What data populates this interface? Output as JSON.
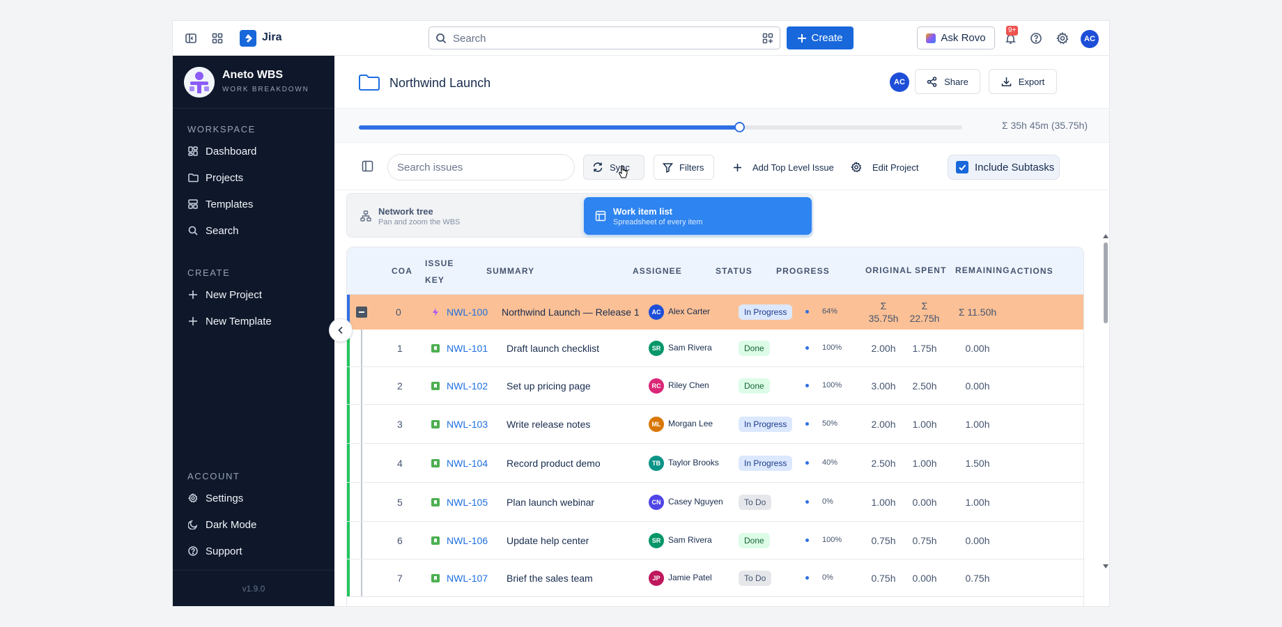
{
  "topbar": {
    "app_name": "Jira",
    "search_placeholder": "Search",
    "create_label": "Create",
    "ask_rovo_label": "Ask Rovo",
    "notification_count": "9+",
    "user_initials": "AC"
  },
  "sidebar": {
    "brand_name": "Aneto WBS",
    "brand_sub": "WORK BREAKDOWN",
    "workspace_title": "WORKSPACE",
    "workspace_items": [
      {
        "label": "Dashboard",
        "icon": "dashboard-icon"
      },
      {
        "label": "Projects",
        "icon": "folder-icon"
      },
      {
        "label": "Templates",
        "icon": "template-icon"
      },
      {
        "label": "Search",
        "icon": "search-icon"
      }
    ],
    "create_title": "CREATE",
    "create_items": [
      {
        "label": "New Project",
        "icon": "plus-icon"
      },
      {
        "label": "New Template",
        "icon": "plus-icon"
      }
    ],
    "account_title": "ACCOUNT",
    "account_items": [
      {
        "label": "Settings",
        "icon": "gear-icon"
      },
      {
        "label": "Dark Mode",
        "icon": "moon-icon"
      },
      {
        "label": "Support",
        "icon": "help-icon"
      }
    ],
    "version": "v1.9.0"
  },
  "project": {
    "title": "Northwind Launch",
    "owner_initials": "AC",
    "share_label": "Share",
    "export_label": "Export",
    "progress_fraction": 0.63,
    "total_time_text": "Σ 35h 45m (35.75h)"
  },
  "toolbar": {
    "search_placeholder": "Search issues",
    "sync_label": "Sync",
    "filters_label": "Filters",
    "add_top_level_label": "Add Top Level Issue",
    "edit_project_label": "Edit Project",
    "include_subtasks_label": "Include Subtasks",
    "include_subtasks_checked": true
  },
  "views": [
    {
      "title": "Network tree",
      "subtitle": "Pan and zoom the WBS",
      "active": false
    },
    {
      "title": "Work item list",
      "subtitle": "Spreadsheet of every item",
      "active": true
    }
  ],
  "table": {
    "headers": {
      "coa": "COA",
      "issue_key_1": "ISSUE",
      "issue_key_2": "KEY",
      "summary": "SUMMARY",
      "assignee": "ASSIGNEE",
      "status": "STATUS",
      "progress": "PROGRESS",
      "original": "ORIGINAL",
      "spent": "SPENT",
      "remaining": "REMAINING",
      "actions": "ACTIONS"
    },
    "rows": [
      {
        "coa": "0",
        "key": "NWL-100",
        "summary": "Northwind Launch — Release 1",
        "initials": "AC",
        "assignee": "Alex Carter",
        "avatar_color": "#1d4ed8",
        "status": "In Progress",
        "status_class": "inprogress",
        "progress": "64%",
        "original": "Σ\n35.75h",
        "spent": "Σ\n22.75h",
        "remaining": "Σ 11.50h",
        "type": "epic"
      },
      {
        "coa": "1",
        "key": "NWL-101",
        "summary": "Draft launch checklist",
        "initials": "SR",
        "assignee": "Sam Rivera",
        "avatar_color": "#059669",
        "status": "Done",
        "status_class": "done",
        "progress": "100%",
        "original": "2.00h",
        "spent": "1.75h",
        "remaining": "0.00h",
        "type": "story"
      },
      {
        "coa": "2",
        "key": "NWL-102",
        "summary": "Set up pricing page",
        "initials": "RC",
        "assignee": "Riley Chen",
        "avatar_color": "#db2777",
        "status": "Done",
        "status_class": "done",
        "progress": "100%",
        "original": "3.00h",
        "spent": "2.50h",
        "remaining": "0.00h",
        "type": "story"
      },
      {
        "coa": "3",
        "key": "NWL-103",
        "summary": "Write release notes",
        "initials": "ML",
        "assignee": "Morgan Lee",
        "avatar_color": "#d97706",
        "status": "In Progress",
        "status_class": "inprogress",
        "progress": "50%",
        "original": "2.00h",
        "spent": "1.00h",
        "remaining": "1.00h",
        "type": "story"
      },
      {
        "coa": "4",
        "key": "NWL-104",
        "summary": "Record product demo",
        "initials": "TB",
        "assignee": "Taylor Brooks",
        "avatar_color": "#0d9488",
        "status": "In Progress",
        "status_class": "inprogress",
        "progress": "40%",
        "original": "2.50h",
        "spent": "1.00h",
        "remaining": "1.50h",
        "type": "story"
      },
      {
        "coa": "5",
        "key": "NWL-105",
        "summary": "Plan launch webinar",
        "initials": "CN",
        "assignee": "Casey Nguyen",
        "avatar_color": "#4f46e5",
        "status": "To Do",
        "status_class": "todo",
        "progress": "0%",
        "original": "1.00h",
        "spent": "0.00h",
        "remaining": "1.00h",
        "type": "story"
      },
      {
        "coa": "6",
        "key": "NWL-106",
        "summary": "Update help center",
        "initials": "SR",
        "assignee": "Sam Rivera",
        "avatar_color": "#059669",
        "status": "Done",
        "status_class": "done",
        "progress": "100%",
        "original": "0.75h",
        "spent": "0.75h",
        "remaining": "0.00h",
        "type": "story"
      },
      {
        "coa": "7",
        "key": "NWL-107",
        "summary": "Brief the sales team",
        "initials": "JP",
        "assignee": "Jamie Patel",
        "avatar_color": "#be185d",
        "status": "To Do",
        "status_class": "todo",
        "progress": "0%",
        "original": "0.75h",
        "spent": "0.00h",
        "remaining": "0.75h",
        "type": "story"
      }
    ]
  }
}
